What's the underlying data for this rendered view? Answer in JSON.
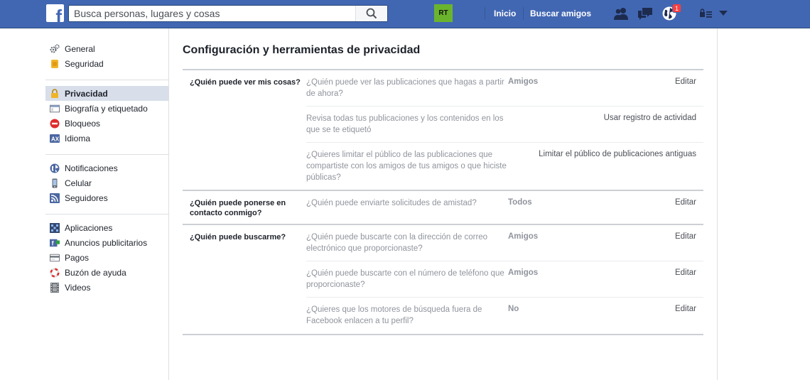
{
  "topbar": {
    "search_placeholder": "Busca personas, lugares y cosas",
    "rt_label": "RT",
    "nav_home": "Inicio",
    "nav_find_friends": "Buscar amigos",
    "notification_count": "1"
  },
  "sidebar": {
    "groups": [
      [
        {
          "label": "General",
          "icon": "gear-icon"
        },
        {
          "label": "Seguridad",
          "icon": "badge-icon"
        }
      ],
      [
        {
          "label": "Privacidad",
          "icon": "lock-icon",
          "active": true
        },
        {
          "label": "Biografía y etiquetado",
          "icon": "timeline-icon"
        },
        {
          "label": "Bloqueos",
          "icon": "block-icon"
        },
        {
          "label": "Idioma",
          "icon": "language-icon"
        }
      ],
      [
        {
          "label": "Notificaciones",
          "icon": "globe-icon"
        },
        {
          "label": "Celular",
          "icon": "phone-icon"
        },
        {
          "label": "Seguidores",
          "icon": "rss-icon"
        }
      ],
      [
        {
          "label": "Aplicaciones",
          "icon": "apps-icon"
        },
        {
          "label": "Anuncios publicitarios",
          "icon": "ads-icon"
        },
        {
          "label": "Pagos",
          "icon": "card-icon"
        },
        {
          "label": "Buzón de ayuda",
          "icon": "lifebuoy-icon"
        },
        {
          "label": "Videos",
          "icon": "film-icon"
        }
      ]
    ]
  },
  "main": {
    "title": "Configuración y herramientas de privacidad",
    "sections": [
      {
        "heading": "¿Quién puede ver mis cosas?",
        "rows": [
          {
            "question": "¿Quién puede ver las publicaciones que hagas a partir de ahora?",
            "value": "Amigos",
            "action": "Editar"
          },
          {
            "question": "Revisa todas tus publicaciones y los contenidos en los que se te etiquetó",
            "value": "",
            "action": "Usar registro de actividad"
          },
          {
            "question": "¿Quieres limitar el público de las publicaciones que compartiste con los amigos de tus amigos o que hiciste públicas?",
            "value": "",
            "action": "Limitar el público de publicaciones antiguas"
          }
        ]
      },
      {
        "heading": "¿Quién puede ponerse en contacto conmigo?",
        "rows": [
          {
            "question": "¿Quién puede enviarte solicitudes de amistad?",
            "value": "Todos",
            "action": "Editar"
          }
        ]
      },
      {
        "heading": "¿Quién puede buscarme?",
        "rows": [
          {
            "question": "¿Quién puede buscarte con la dirección de correo electrónico que proporcionaste?",
            "value": "Amigos",
            "action": "Editar"
          },
          {
            "question": "¿Quién puede buscarte con el número de teléfono que proporcionaste?",
            "value": "Amigos",
            "action": "Editar"
          },
          {
            "question": "¿Quieres que los motores de búsqueda fuera de Facebook enlacen a tu perfil?",
            "value": "No",
            "action": "Editar"
          }
        ]
      }
    ]
  }
}
